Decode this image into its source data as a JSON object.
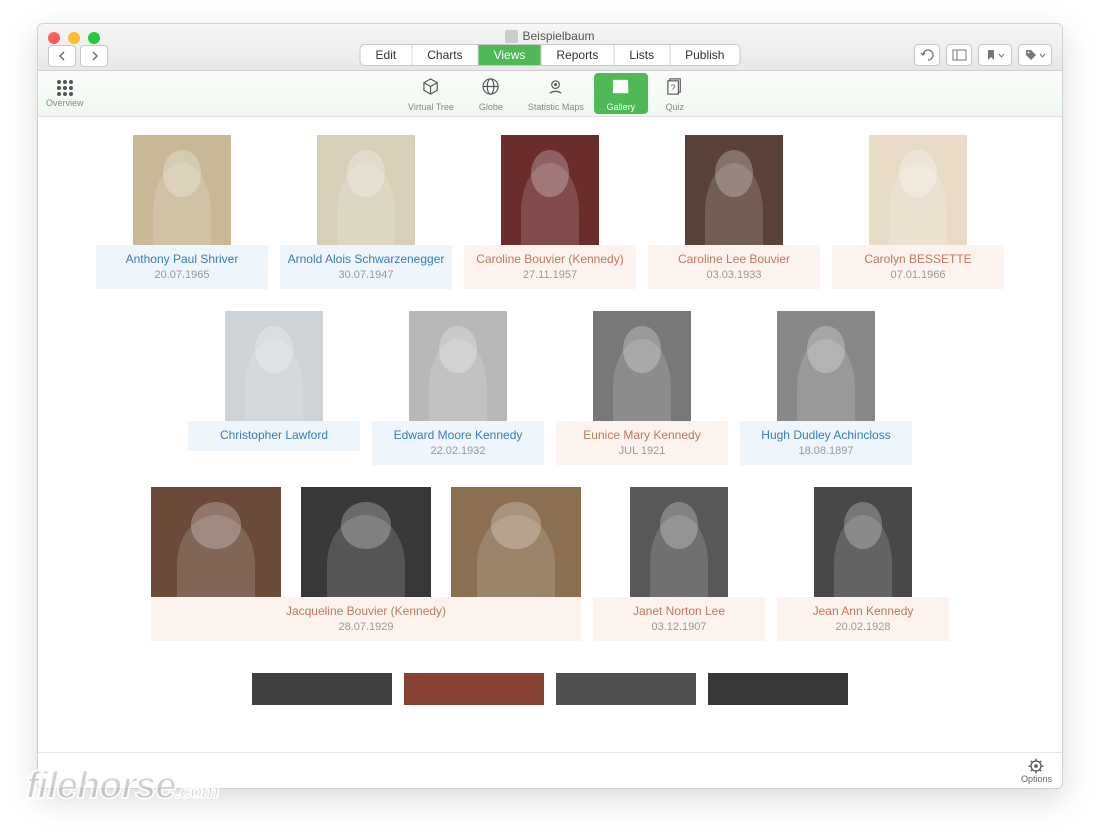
{
  "window": {
    "title": "Beispielbaum"
  },
  "toolbar": {
    "tabs": [
      "Edit",
      "Charts",
      "Views",
      "Reports",
      "Lists",
      "Publish"
    ],
    "active": "Views"
  },
  "subtoolbar": {
    "overview": "Overview",
    "tabs": [
      "Virtual Tree",
      "Globe",
      "Statistic Maps",
      "Gallery",
      "Quiz"
    ],
    "active": "Gallery"
  },
  "bottombar": {
    "options": "Options"
  },
  "gallery": {
    "rows": [
      [
        {
          "name": "Anthony Paul Shriver",
          "date": "20.07.1965",
          "gender": "m",
          "bg": "#c8b896"
        },
        {
          "name": "Arnold Alois Schwarzenegger",
          "date": "30.07.1947",
          "gender": "m",
          "bg": "#d8cfb8"
        },
        {
          "name": "Caroline Bouvier (Kennedy)",
          "date": "27.11.1957",
          "gender": "f",
          "bg": "#6b2c2c"
        },
        {
          "name": "Caroline Lee Bouvier",
          "date": "03.03.1933",
          "gender": "f",
          "bg": "#5a4238"
        },
        {
          "name": "Carolyn BESSETTE",
          "date": "07.01.1966",
          "gender": "f",
          "bg": "#e8dcc8"
        }
      ],
      [
        {
          "name": "Christopher Lawford",
          "date": "",
          "gender": "m",
          "bg": "#cdd3d6"
        },
        {
          "name": "Edward Moore Kennedy",
          "date": "22.02.1932",
          "gender": "m",
          "bg": "#b8b8b8"
        },
        {
          "name": "Eunice Mary Kennedy",
          "date": "JUL 1921",
          "gender": "f",
          "bg": "#787878"
        },
        {
          "name": "Hugh Dudley Achincloss",
          "date": "18.08.1897",
          "gender": "m",
          "bg": "#888888"
        }
      ],
      [
        {
          "name": "Jacqueline Bouvier (Kennedy)",
          "date": "28.07.1929",
          "gender": "f",
          "bg": "#6b4a3a",
          "special": "wide"
        },
        {
          "name": "Janet Norton Lee",
          "date": "03.12.1907",
          "gender": "f",
          "bg": "#585858"
        },
        {
          "name": "Jean Ann Kennedy",
          "date": "20.02.1928",
          "gender": "f",
          "bg": "#484848"
        }
      ]
    ]
  },
  "watermark": {
    "text": "filehorse",
    "suffix": ".com"
  }
}
